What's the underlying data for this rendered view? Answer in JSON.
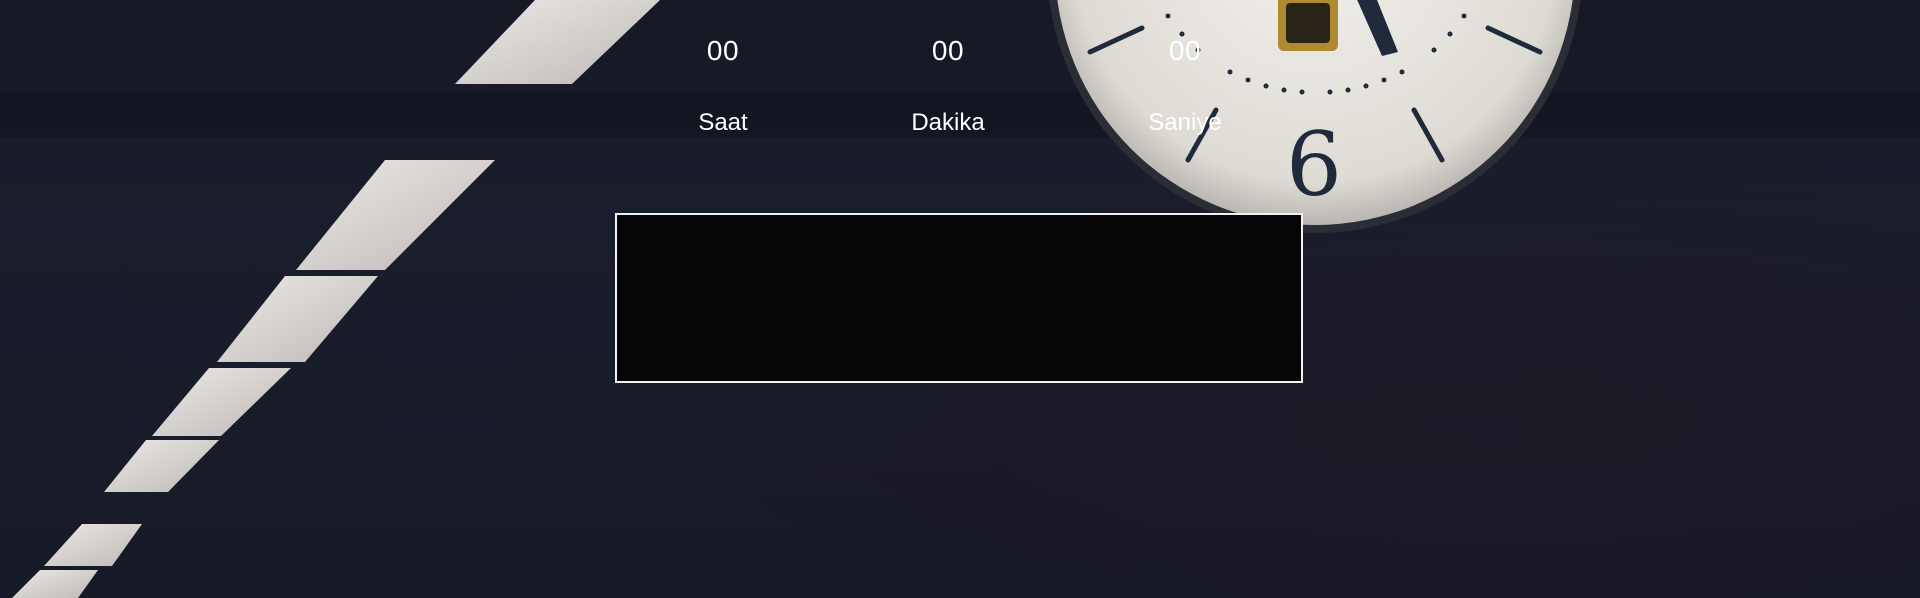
{
  "countdown": {
    "hours": {
      "value": "00",
      "label": "Saat"
    },
    "minutes": {
      "value": "00",
      "label": "Dakika"
    },
    "seconds": {
      "value": "00",
      "label": "Saniye"
    }
  },
  "background": {
    "clock_numeral": "6",
    "colors": {
      "backdrop": "#171a26",
      "panel": "#060608",
      "panel_border": "#f2f2f2",
      "text": "#ffffff",
      "light": "#d9d6d4",
      "clock_face": "#e8e6e1"
    }
  }
}
